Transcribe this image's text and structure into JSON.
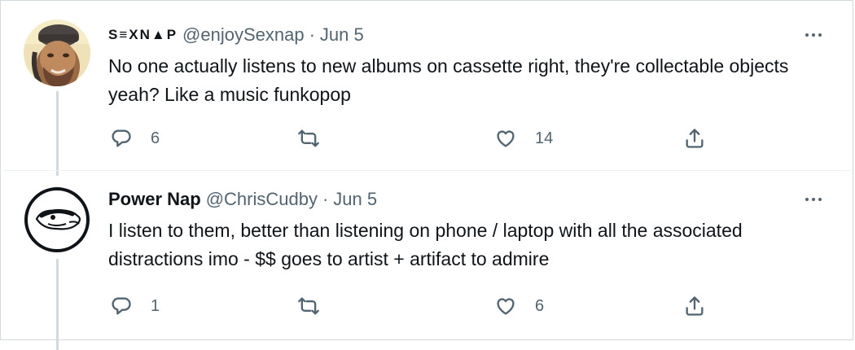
{
  "tweets": [
    {
      "display_name": "S≡XN▲P",
      "handle": "@enjoySexnap",
      "separator": "·",
      "date": "Jun 5",
      "text": "No one actually listens to new albums on cassette right, they're collectable objects yeah? Like a music funkopop",
      "reply_count": "6",
      "retweet_count": "",
      "like_count": "14"
    },
    {
      "display_name": "Power Nap",
      "handle": "@ChrisCudby",
      "separator": "·",
      "date": "Jun 5",
      "text": "I listen to them, better than listening on phone / laptop with all the associated distractions imo - $$ goes to artist + artifact to admire",
      "reply_count": "1",
      "retweet_count": "",
      "like_count": "6"
    }
  ],
  "icons": {
    "more": "more-icon",
    "reply": "reply-icon",
    "retweet": "retweet-icon",
    "like": "like-icon",
    "share": "share-icon"
  },
  "colors": {
    "text": "#0f1419",
    "secondary": "#536471",
    "thread_line": "#cfd9de",
    "background": "#ffffff"
  }
}
